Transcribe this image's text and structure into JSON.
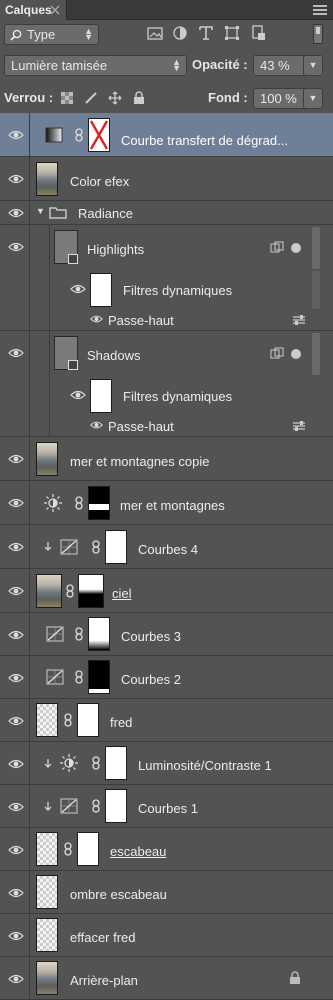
{
  "panel": {
    "tab_title": "Calques"
  },
  "filter": {
    "kind_label": "Type",
    "icons": [
      "pixel-filter-icon",
      "adjustment-filter-icon",
      "type-filter-icon",
      "shape-filter-icon",
      "smartobject-filter-icon"
    ]
  },
  "blend": {
    "mode": "Lumière tamisée",
    "opacity_label": "Opacité :",
    "opacity_value": "43 %"
  },
  "lock": {
    "label": "Verrou :",
    "fill_label": "Fond :",
    "fill_value": "100 %"
  },
  "layers": [
    {
      "name": "Courbe transfert de dégrad...",
      "selected": true
    },
    {
      "name": "Color efex"
    },
    {
      "name": "Radiance"
    },
    {
      "name": "Highlights"
    },
    {
      "name": "Filtres dynamiques"
    },
    {
      "name": "Passe-haut"
    },
    {
      "name": "Shadows"
    },
    {
      "name": "Filtres dynamiques"
    },
    {
      "name": "Passe-haut"
    },
    {
      "name": "mer et montagnes copie"
    },
    {
      "name": "mer et montagnes"
    },
    {
      "name": "Courbes 4"
    },
    {
      "name": "ciel"
    },
    {
      "name": "Courbes 3"
    },
    {
      "name": "Courbes 2"
    },
    {
      "name": "fred"
    },
    {
      "name": "Luminosité/Contraste 1"
    },
    {
      "name": "Courbes 1"
    },
    {
      "name": "escabeau"
    },
    {
      "name": "ombre escabeau"
    },
    {
      "name": "effacer fred"
    },
    {
      "name": "Arrière-plan"
    }
  ]
}
